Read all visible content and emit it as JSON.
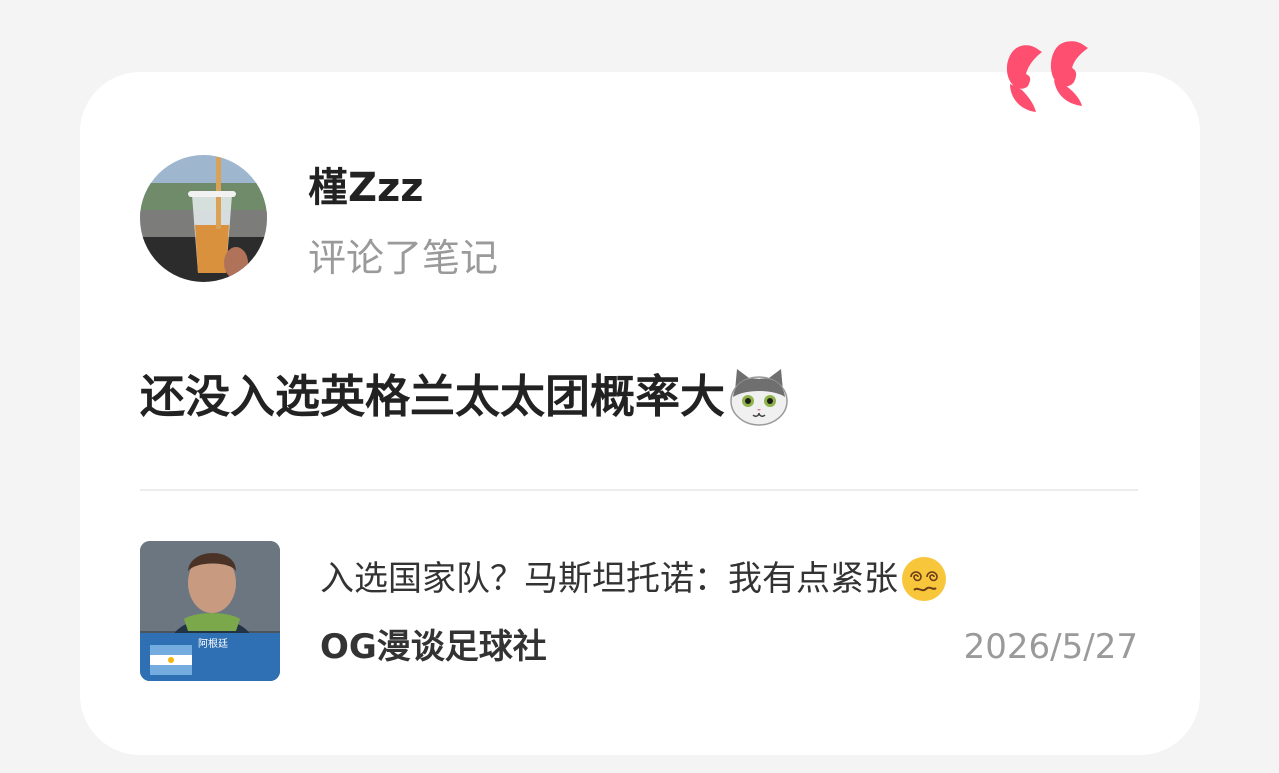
{
  "colors": {
    "accent": "#ff4f70",
    "background": "#f4f4f4",
    "card": "#ffffff",
    "primary_text": "#222222",
    "secondary_text": "#9a9a9a"
  },
  "header": {
    "quote_icon": "quote-mark-icon"
  },
  "user": {
    "name": "槿Zzz",
    "action": "评论了笔记",
    "avatar_icon": "drink-cup-photo"
  },
  "comment": {
    "text": "还没入选英格兰太太团概率大",
    "emoji": "cat-face-emoji"
  },
  "note": {
    "title": "入选国家队？马斯坦托诺：我有点紧张",
    "title_emoji": "dizzy-face-emoji",
    "author": "OG漫谈足球社",
    "date": "2026/5/27",
    "thumbnail_caption": "阿根廷"
  }
}
